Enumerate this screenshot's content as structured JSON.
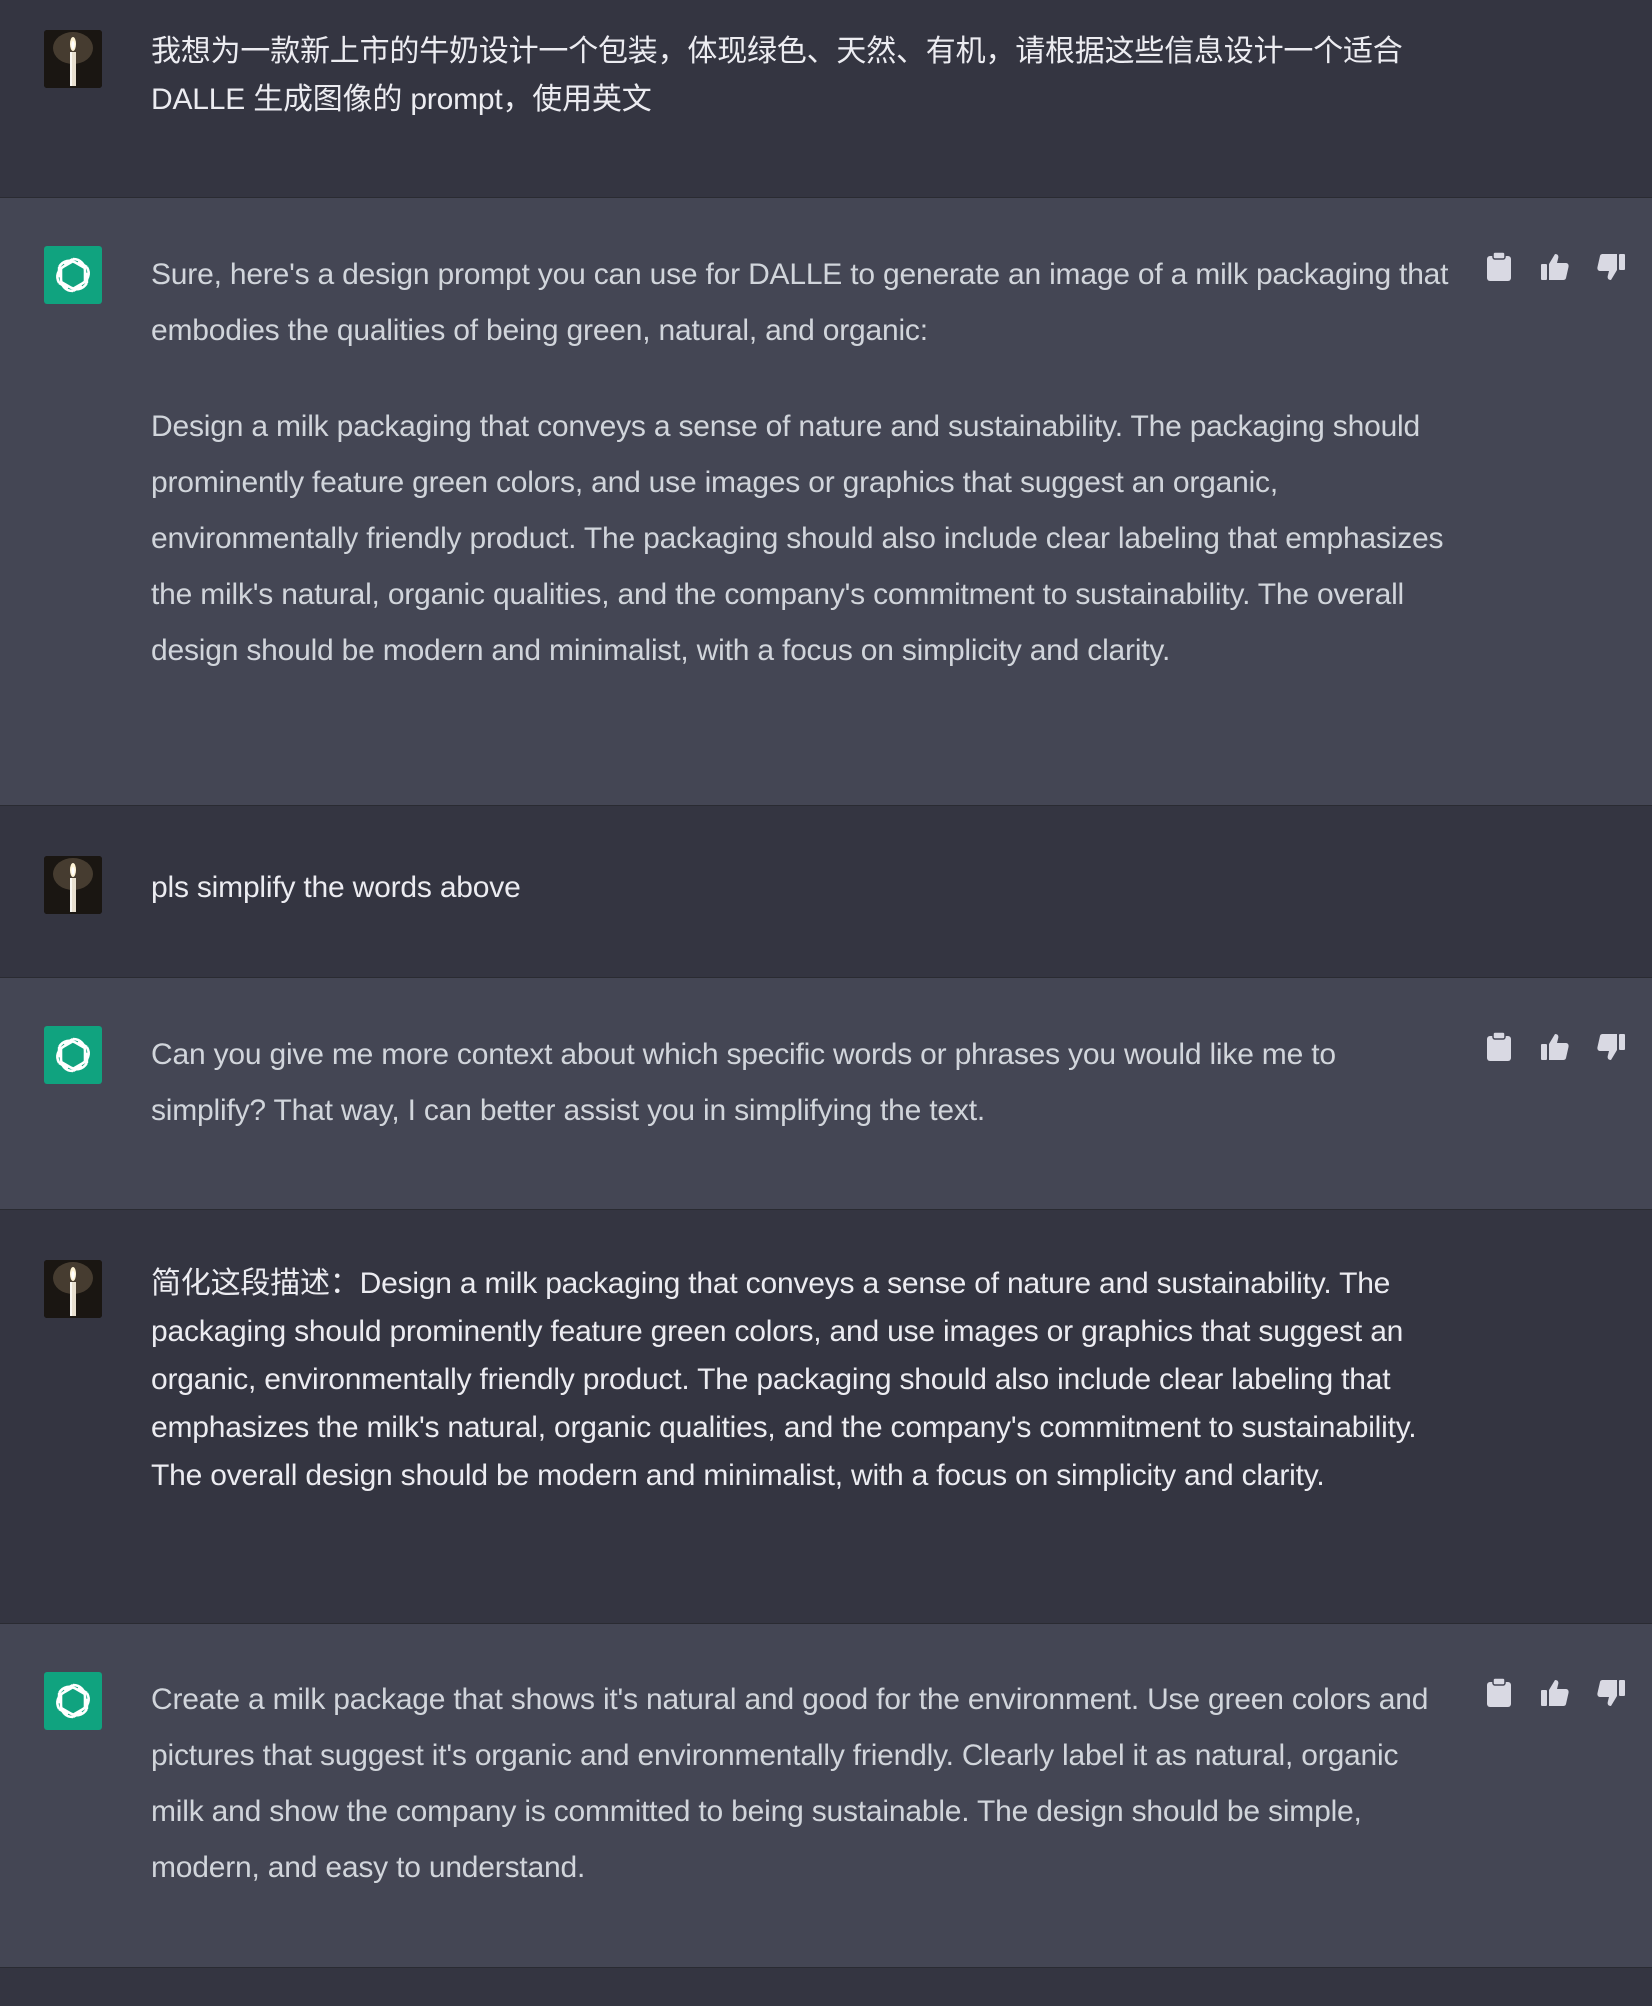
{
  "conversation": {
    "messages": [
      {
        "role": "user",
        "paragraphs": [
          "我想为一款新上市的牛奶设计一个包装，体现绿色、天然、有机，请根据这些信息设计一个适合 DALLE 生成图像的 prompt，使用英文"
        ]
      },
      {
        "role": "assistant",
        "paragraphs": [
          "Sure, here's a design prompt you can use for DALLE to generate an image of a milk packaging that embodies the qualities of being green, natural, and organic:",
          "Design a milk packaging that conveys a sense of nature and sustainability. The packaging should prominently feature green colors, and use images or graphics that suggest an organic, environmentally friendly product. The packaging should also include clear labeling that emphasizes the milk's natural, organic qualities, and the company's commitment to sustainability. The overall design should be modern and minimalist, with a focus on simplicity and clarity."
        ]
      },
      {
        "role": "user",
        "paragraphs": [
          "pls simplify the words above"
        ]
      },
      {
        "role": "assistant",
        "paragraphs": [
          "Can you give me more context about which specific words or phrases you would like me to simplify? That way, I can better assist you in simplifying the text."
        ]
      },
      {
        "role": "user",
        "paragraphs": [
          "简化这段描述：Design a milk packaging that conveys a sense of nature and sustainability. The packaging should prominently feature green colors, and use images or graphics that suggest an organic, environmentally friendly product. The packaging should also include clear labeling that emphasizes the milk's natural, organic qualities, and the company's commitment to sustainability. The overall design should be modern and minimalist, with a focus on simplicity and clarity."
        ]
      },
      {
        "role": "assistant",
        "paragraphs": [
          "Create a milk package that shows it's natural and good for the environment. Use green colors and pictures that suggest it's organic and environmentally friendly. Clearly label it as natural, organic milk and show the company is committed to being sustainable. The design should be simple, modern, and easy to understand."
        ]
      }
    ]
  },
  "icons": {
    "copy": "clipboard-icon",
    "like": "thumbs-up-icon",
    "dislike": "thumbs-down-icon",
    "assistant_avatar": "openai-logo-icon",
    "user_avatar": "candle-photo-avatar"
  },
  "colors": {
    "user_bg": "#343541",
    "assistant_bg": "#444654",
    "assistant_avatar_bg": "#10a37f",
    "text_user": "#ececf1",
    "text_assistant": "#d1d5db",
    "icon": "#d9d9e3"
  }
}
